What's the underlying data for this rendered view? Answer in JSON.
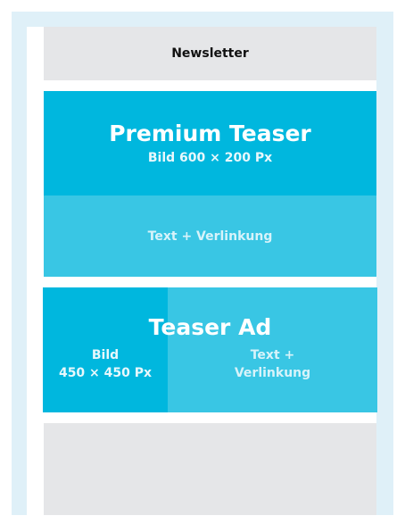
{
  "newsletter": {
    "label": "Newsletter"
  },
  "premium_teaser": {
    "title": "Premium Teaser",
    "image_label": "Bild 600 × 200 Px",
    "text_label": "Text + Verlinkung"
  },
  "teaser_ad": {
    "title": "Teaser Ad",
    "image_label_line1": "Bild",
    "image_label_line2": "450 × 450 Px",
    "text_label_line1": "Text +",
    "text_label_line2": "Verlinkung"
  },
  "colors": {
    "frame": "#dff0f8",
    "cyan_dark": "#00b7de",
    "cyan_light": "#39c6e4",
    "grey_block": "#e5e6e8"
  }
}
